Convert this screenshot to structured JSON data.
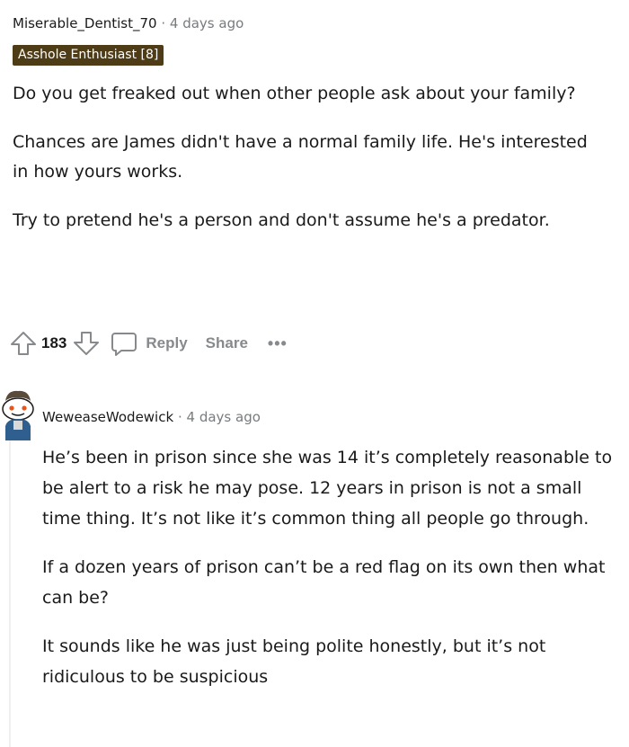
{
  "comment": {
    "author": "Miserable_Dentist_70",
    "separator": "·",
    "time": "4 days ago",
    "flair": "Asshole Enthusiast [8]",
    "paragraphs": [
      "Do you get freaked out when other people ask about your family?",
      "Chances are James didn't have a normal family life. He's interested in how yours works.",
      "Try to pretend he's a person and don't assume he's a predator."
    ],
    "score": "183",
    "reply_label": "Reply",
    "share_label": "Share",
    "more_label": "•••",
    "icons": {
      "upvote": "upvote-arrow-icon",
      "downvote": "downvote-arrow-icon",
      "reply": "speech-bubble-icon",
      "more": "ellipsis-icon"
    }
  },
  "reply": {
    "author": "WeweaseWodewick",
    "separator": "·",
    "time": "4 days ago",
    "paragraphs": [
      "He’s been in prison since she was 14 it’s completely reasonable to be alert to a risk he may pose. 12 years in prison is not a small time thing. It’s not like it’s common thing all people go through.",
      "If a dozen years of prison can’t be a red flag on its own then what can be?",
      "It sounds like he was just being polite honestly, but it’s not ridiculous to be suspicious"
    ],
    "avatar_icon": "snoo-avatar-icon"
  },
  "colors": {
    "flair_bg": "#4e3c17",
    "muted": "#787c7e",
    "action": "#878a8c",
    "text": "#1a1a1b"
  }
}
